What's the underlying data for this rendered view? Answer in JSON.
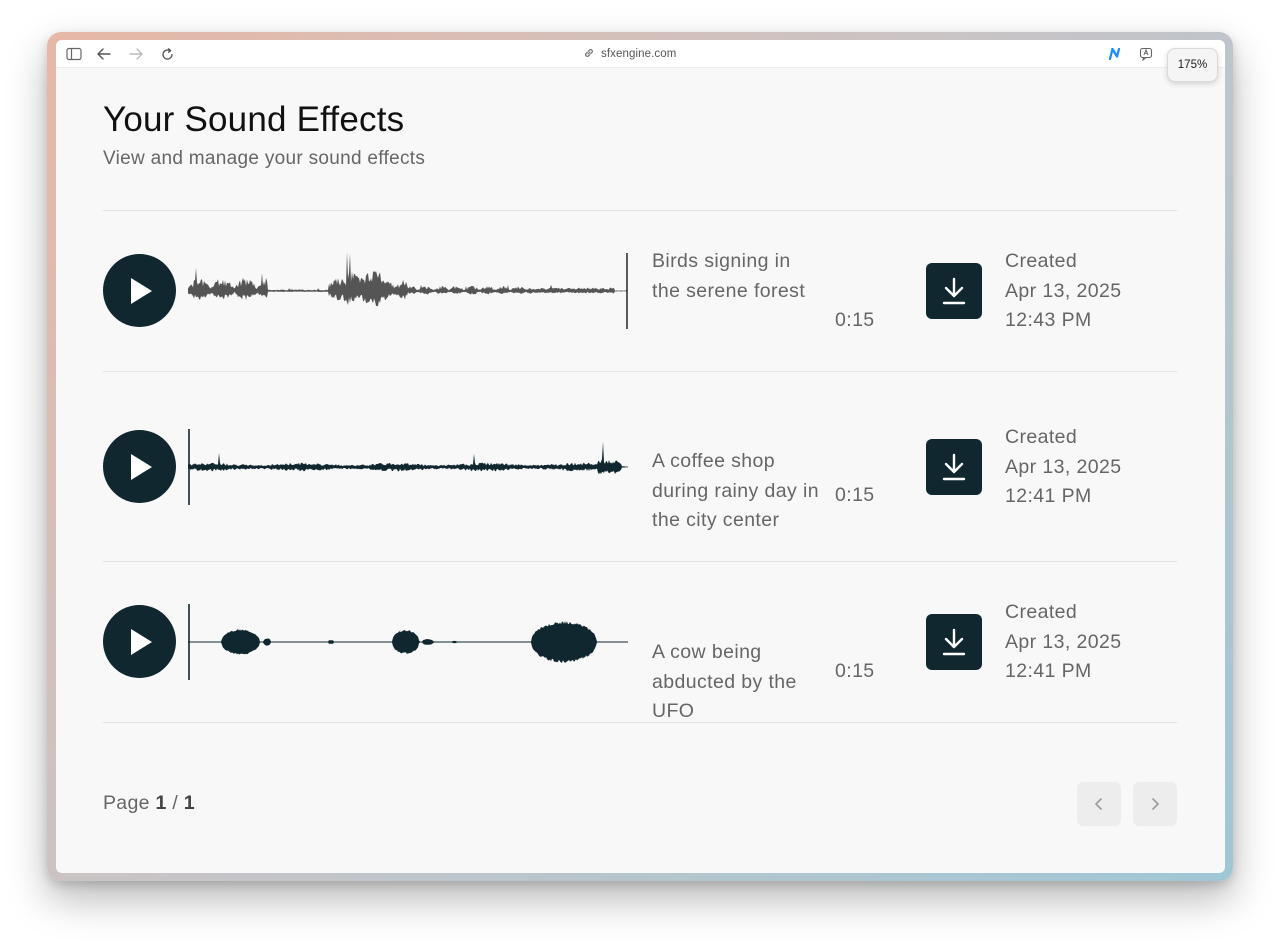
{
  "browser": {
    "url": "sfxengine.com",
    "zoom": "175%"
  },
  "page": {
    "title": "Your Sound Effects",
    "subtitle": "View and manage your sound effects"
  },
  "effects": [
    {
      "description": "Birds signing in the serene forest",
      "duration": "0:15",
      "created_label": "Created",
      "created_date": "Apr 13, 2025",
      "created_time": "12:43 PM",
      "playhead_at_end": true
    },
    {
      "description": "A coffee shop during rainy day in the city center",
      "duration": "0:15",
      "created_label": "Created",
      "created_date": "Apr 13, 2025",
      "created_time": "12:41 PM",
      "playhead_at_end": false
    },
    {
      "description": "A cow being abducted by the UFO",
      "duration": "0:15",
      "created_label": "Created",
      "created_date": "Apr 13, 2025",
      "created_time": "12:41 PM",
      "playhead_at_end": false
    }
  ],
  "pagination": {
    "prefix": "Page",
    "current": "1",
    "separator": "/",
    "total": "1"
  },
  "colors": {
    "accent": "#102730",
    "wave_played": "#555555",
    "text_muted": "#666666"
  },
  "icons": {
    "play": "play-icon",
    "download": "download-icon",
    "prev": "chevron-left-icon",
    "next": "chevron-right-icon"
  }
}
